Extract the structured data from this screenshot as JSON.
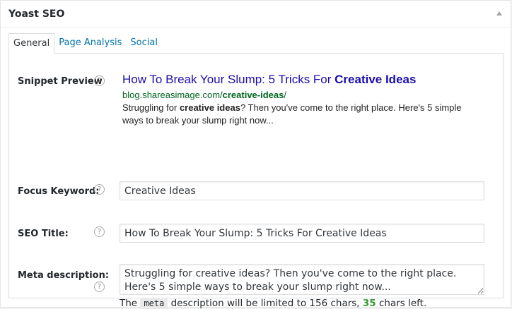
{
  "metabox": {
    "title": "Yoast SEO"
  },
  "tabs": [
    {
      "label": "General",
      "active": true
    },
    {
      "label": "Page Analysis",
      "active": false
    },
    {
      "label": "Social",
      "active": false
    }
  ],
  "snippet": {
    "label": "Snippet Preview",
    "title_plain": "How To Break Your Slump: 5 Tricks For ",
    "title_bold": "Creative Ideas",
    "url_plain": "blog.shareasimage.com/",
    "url_bold": "creative-ideas",
    "url_end": "/",
    "desc_pre": "Struggling for ",
    "desc_bold": "creative ideas",
    "desc_post": "? Then you've come to the right place. Here's 5 simple ways to break your slump right now..."
  },
  "focus_keyword": {
    "label": "Focus Keyword:",
    "value": "Creative Ideas"
  },
  "seo_title": {
    "label": "SEO Title:",
    "value": "How To Break Your Slump: 5 Tricks For Creative Ideas"
  },
  "meta_description": {
    "label": "Meta description:",
    "value": "Struggling for creative ideas? Then you've come to the right place. Here's 5 simple ways to break your slump right now...",
    "note_pre": "The ",
    "note_code": "meta",
    "note_mid": " description will be limited to 156 chars, ",
    "note_count": "35",
    "note_post": " chars left."
  },
  "help_glyph": "?",
  "colors": {
    "link": "#0073aa",
    "snippet_title": "#1a0dab",
    "snippet_url": "#006621",
    "count": "#339933"
  }
}
